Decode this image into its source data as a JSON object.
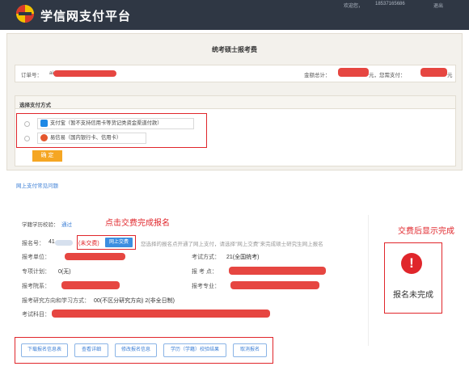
{
  "header": {
    "site_title": "学信网支付平台",
    "welcome": "欢迎您，",
    "phone": "18537165686",
    "logout": "退出"
  },
  "payment_panel": {
    "title": "统考硕士报考费",
    "order_label": "订单号：",
    "order_prefix": "ai",
    "amount_label": "金额总计：",
    "amount_suffix": "元，您需支付：",
    "pay_suffix": "元",
    "method_title": "选择支付方式",
    "options": [
      {
        "label": "支付宝（暂不支持信用卡等货记类资金渠道付款）",
        "icon": "alipay-icon",
        "color": "#1e88e5"
      },
      {
        "label": "易信易（国内银行卡、信用卡）",
        "icon": "bank-icon",
        "color": "#e4572e"
      }
    ],
    "confirm_label": "确 定",
    "faq_link": "网上支付常见问题"
  },
  "registration": {
    "annotation_pay": "点击交费完成报名",
    "annotation_status": "交费后显示完成",
    "verify_label": "学籍学历校验：",
    "verify_value": "通过",
    "reg_no_label": "报名号：",
    "reg_no_prefix": "41",
    "status_inline": "(未交费)",
    "pay_button": "网上交费",
    "hint": "您选择的报名点开通了网上支付，请选择\"网上交费\"来完成硕士研究生网上报名",
    "fields": {
      "unit_label": "报考单位：",
      "exam_mode_label": "考试方式：",
      "exam_mode_value": "21(全国统考)",
      "special_plan_label": "专项计划：",
      "special_plan_value": "0(无)",
      "site_label": "报 考 点：",
      "dept_label": "报考院系：",
      "major_label": "报考专业：",
      "direction_label": "报考研究方向和学习方式：",
      "direction_value": "00(不区分研究方向) 2(非全日制)",
      "subjects_label": "考试科目："
    },
    "status_card_icon": "!",
    "status_card_text": "报名未完成",
    "actions": [
      "下载报名信息表",
      "查看详细",
      "修改报名信息",
      "学历（学籍）校验结果",
      "取消报名"
    ]
  },
  "colors": {
    "header_bg": "#2f3744",
    "accent_orange": "#f5a623",
    "link_blue": "#3c7fd6",
    "annotation_red": "#e0262b"
  }
}
